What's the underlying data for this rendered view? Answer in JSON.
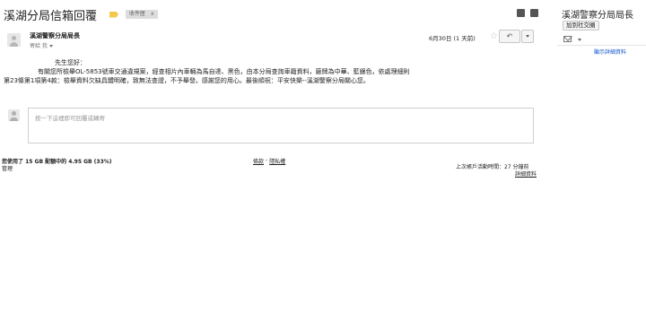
{
  "thread": {
    "subject": "溪湖分局信箱回覆",
    "inbox_label": "收件匣",
    "inbox_close": "x"
  },
  "top_icons": [
    "print-icon",
    "new-window-icon"
  ],
  "message": {
    "sender": "溪湖警察分局局長",
    "to_line": "寄給 我",
    "date": "6月30日 (1 天前)",
    "star": "☆",
    "reply_glyph": "↶",
    "greeting": "先生您好：",
    "paragraph": "有關您所檢舉OL-5853號車交通違規案，經查相片內車輛為馬自達、黑色，由本分局查詢車籍資料，廠牌為中華、藍銀色，依處理細則",
    "paragraph_cont": "第23條第1項第4款：檢舉資料欠缺具體明確，致無法查證，不予舉發。感謝您的用心。最後順祝：平安快樂--溪湖警察分局關心您。"
  },
  "reply": {
    "placeholder": "按一下這裡即可回覆或轉寄"
  },
  "footer": {
    "quota": "您使用了 15 GB 配額中的 4.95 GB (33%)",
    "manage": "管理",
    "terms": "條款",
    "separator": " - ",
    "privacy": "隱私權",
    "last_activity": "上次帳戶活動時間：27 分鐘前",
    "details": "詳細資料"
  },
  "sidebar": {
    "name": "溪湖警察分局局長",
    "add_circle": "加到社交圈",
    "show_details": "顯示詳細資料"
  }
}
